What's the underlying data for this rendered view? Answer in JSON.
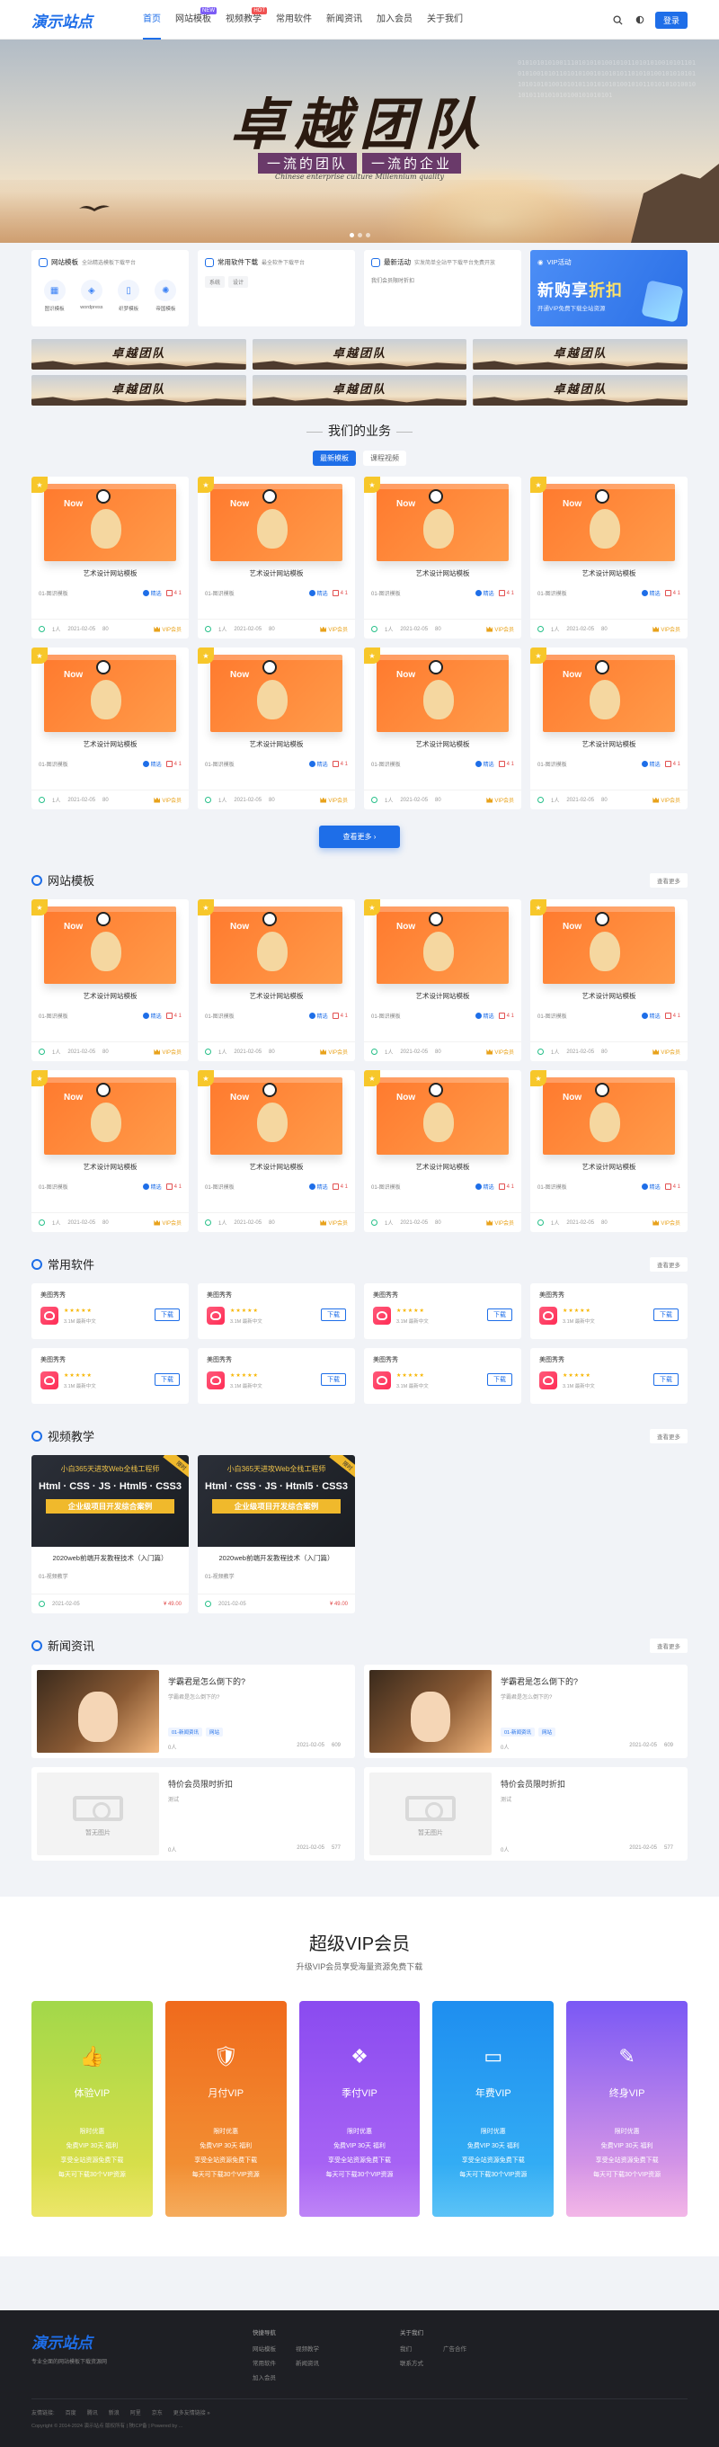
{
  "header": {
    "logo": "演示站点",
    "nav": [
      {
        "label": "首页",
        "active": true,
        "badge": ""
      },
      {
        "label": "网站模板",
        "active": false,
        "badge": "NEW",
        "badge_color": "#7b5cf5"
      },
      {
        "label": "视频教学",
        "active": false,
        "badge": "HOT",
        "badge_color": "#f05252"
      },
      {
        "label": "常用软件",
        "active": false,
        "badge": ""
      },
      {
        "label": "新闻资讯",
        "active": false,
        "badge": ""
      },
      {
        "label": "加入会员",
        "active": false,
        "badge": ""
      },
      {
        "label": "关于我们",
        "active": false,
        "badge": ""
      }
    ],
    "login": "登录"
  },
  "banner": {
    "title": "卓越团队",
    "sub1": "一流的团队",
    "sub2": "一流的企业",
    "en": "Chinese enterprise culture    Millennium quality",
    "binary": "0101010101001110101010100101011010101001010110101010010101101010100101010101101010100101010101101010101001010101101010101001010110101010100101010110101010100101010101"
  },
  "quick": {
    "c1": {
      "title": "网站模板",
      "desc": "全站精选模板下载平台",
      "items": [
        "图识模板",
        "wordpress",
        "织梦模板",
        "帝国模板"
      ]
    },
    "c2": {
      "title": "常用软件下载",
      "desc": "最全软件下载平台",
      "tags": [
        "系统",
        "设计"
      ]
    },
    "c3": {
      "title": "最新活动",
      "desc": "实发简单全站平下载平台免费开放",
      "note": "我们会员限时折扣"
    },
    "c4": {
      "title": "VIP活动",
      "big1": "新购享",
      "big2": "折扣",
      "small": "开通VIP免费下载全站资源"
    }
  },
  "ads": [
    "卓越团队",
    "卓越团队",
    "卓越团队",
    "卓越团队",
    "卓越团队",
    "卓越团队"
  ],
  "business": {
    "title": "我们的业务",
    "tabs": [
      "最新模板",
      "课程视频"
    ],
    "more_btn": "查看更多 ›"
  },
  "product": {
    "screen_text": "Now",
    "title": "艺术设计网站模板",
    "cat": "01-图识模板",
    "tag": "精选",
    "count": "4 1",
    "views": "1人",
    "date": "2021-02-05",
    "hits": "80",
    "vip": "VIP会员"
  },
  "sections": {
    "templates": {
      "title": "网站模板",
      "more": "查看更多"
    },
    "software": {
      "title": "常用软件",
      "more": "查看更多"
    },
    "videos": {
      "title": "视频教学",
      "more": "查看更多"
    },
    "news": {
      "title": "新闻资讯",
      "more": "查看更多"
    }
  },
  "software": {
    "name": "美图秀秀",
    "stars": "★★★★★",
    "info": "3.1M  最新中文",
    "download": "下载"
  },
  "videos": {
    "top": "小白365天进攻Web全栈工程师",
    "mid": "Html · CSS · JS · Html5 · CSS3",
    "bar": "企业级项目开发综合案例",
    "ribbon": "限时",
    "title": "2020web前端开发教程技术（入门篇）",
    "cat": "01-视频教学",
    "date": "2021-02-05",
    "price": "¥ 49.00"
  },
  "news": [
    {
      "title": "学霸君是怎么倒下的?",
      "sub": "学霸君是怎么倒下的?",
      "tags": [
        "01-新闻资讯",
        "网站"
      ],
      "views": "0人",
      "date": "2021-02-05",
      "hits": "609"
    },
    {
      "title": "学霸君是怎么倒下的?",
      "sub": "学霸君是怎么倒下的?",
      "tags": [
        "01-新闻资讯",
        "网站"
      ],
      "views": "0人",
      "date": "2021-02-05",
      "hits": "609"
    },
    {
      "title": "特价会员限时折扣",
      "sub": "测试",
      "tags": [],
      "views": "0人",
      "date": "2021-02-05",
      "hits": "577",
      "placeholder": "暂无图片"
    },
    {
      "title": "特价会员限时折扣",
      "sub": "测试",
      "tags": [],
      "views": "0人",
      "date": "2021-02-05",
      "hits": "577",
      "placeholder": "暂无图片"
    }
  ],
  "vip": {
    "title": "超级VIP会员",
    "sub": "升级VIP会员享受海量资源免费下载",
    "perks": [
      "限时优惠",
      "免费VIP 30天 福利",
      "享受全站资源免费下载",
      "每天可下载30个VIP资源"
    ],
    "cards": [
      {
        "name": "体验VIP",
        "icon": "👍",
        "color1": "#a2d84a",
        "color2": "#e8e14a"
      },
      {
        "name": "月付VIP",
        "icon": "🛡",
        "color1": "#f06a1c",
        "color2": "#f39a3a"
      },
      {
        "name": "季付VIP",
        "icon": "❖",
        "color1": "#8a4bf0",
        "color2": "#b06af5"
      },
      {
        "name": "年费VIP",
        "icon": "▭",
        "color1": "#1e8ef0",
        "color2": "#39b6f5"
      },
      {
        "name": "终身VIP",
        "icon": "✎",
        "color1": "#7a58f5",
        "color2": "#f0a7e2"
      }
    ]
  },
  "footer": {
    "logo": "演示站点",
    "desc": "专业全面的网站模板下载资源网",
    "col1_title": "快捷导航",
    "col1": [
      "网站模板",
      "视频教学",
      "常用软件",
      "新闻资讯",
      "加入会员"
    ],
    "col2_title": "关于我们",
    "col2": [
      "我们",
      "广告合作",
      "联系方式"
    ],
    "bar": [
      "友情链接:",
      "百度",
      "腾讯",
      "新浪",
      "阿里",
      "京东",
      "更多友情链接 »"
    ],
    "copyright": "Copyright © 2014-2024 演示站点 版权所有  |  陕ICP备  |  Powered by ..."
  }
}
